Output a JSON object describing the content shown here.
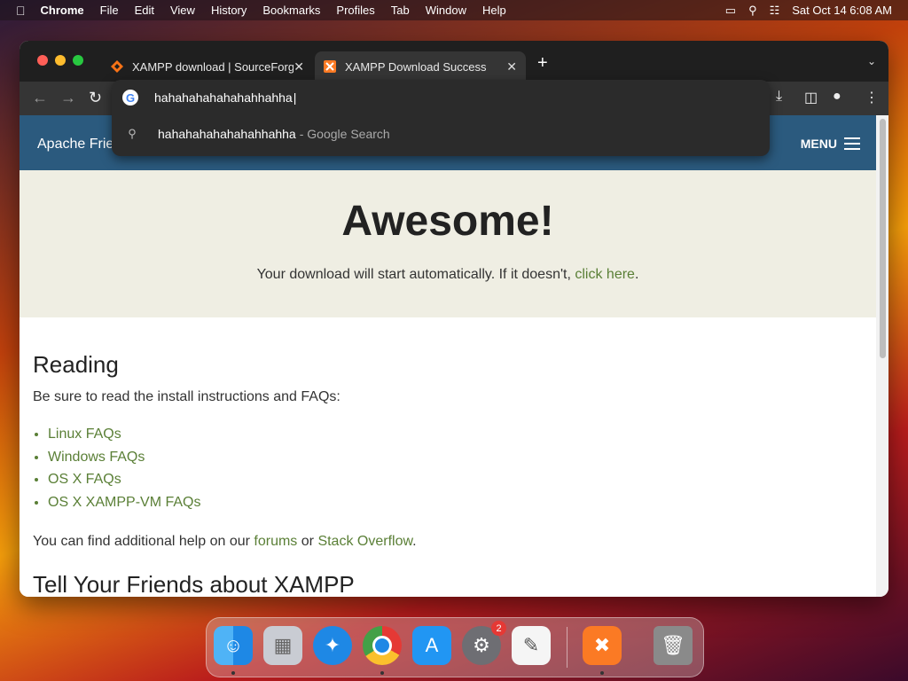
{
  "menubar": {
    "app": "Chrome",
    "items": [
      "File",
      "Edit",
      "View",
      "History",
      "Bookmarks",
      "Profiles",
      "Tab",
      "Window",
      "Help"
    ],
    "datetime": "Sat Oct 14  6:08 AM"
  },
  "tabs": [
    {
      "title": "XAMPP download | SourceForge",
      "favicon_color": "#f97316",
      "active": false
    },
    {
      "title": "XAMPP Download Success",
      "favicon_color": "#fb7a24",
      "active": true
    }
  ],
  "omnibox": {
    "text": "hahahahahahahahhahha",
    "suggestion_query": "hahahahahahahahhahha",
    "suggestion_suffix": "- Google Search"
  },
  "site": {
    "brand": "Apache Frie",
    "menu_label": "MENU",
    "hero_title": "Awesome!",
    "hero_text": "Your download will start automatically. If it doesn't,",
    "hero_link": "click here",
    "hero_end": ".",
    "reading_heading": "Reading",
    "reading_text": "Be sure to read the install instructions and FAQs:",
    "faq_links": [
      "Linux FAQs",
      "Windows FAQs",
      "OS X FAQs",
      "OS X XAMPP-VM FAQs"
    ],
    "help_text_1": "You can find additional help on our",
    "help_link_forums": "forums",
    "help_text_or": "or",
    "help_link_so": "Stack Overflow",
    "help_end": ".",
    "next_heading": "Tell Your Friends about XAMPP"
  },
  "dock": {
    "apps": [
      "finder",
      "launchpad",
      "safari",
      "chrome",
      "app-store",
      "system-settings",
      "textedit",
      "xampp",
      "trash"
    ],
    "settings_badge": "2"
  },
  "colors": {
    "link": "#5a7f36",
    "sitebar": "#2b5a7e",
    "hero_bg": "#efeee3"
  }
}
